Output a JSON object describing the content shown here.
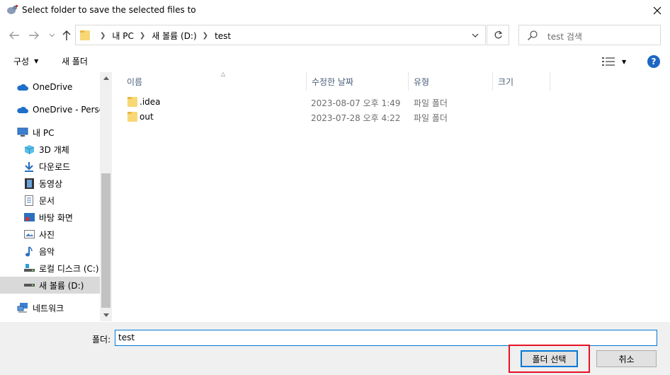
{
  "window": {
    "title": "Select folder to save the selected files to"
  },
  "address": {
    "crumbs": [
      "내 PC",
      "새 볼륨 (D:)",
      "test"
    ]
  },
  "search": {
    "placeholder": "test 검색"
  },
  "toolbar": {
    "organize_label": "구성",
    "new_folder_label": "새 폴더",
    "help_label": "?"
  },
  "sidebar": {
    "items": [
      {
        "label": "OneDrive",
        "icon": "cloud-icon"
      },
      {
        "label": "OneDrive - Personal",
        "icon": "cloud-icon"
      },
      {
        "label": "내 PC",
        "icon": "computer-icon"
      },
      {
        "label": "3D 개체",
        "icon": "cube-icon"
      },
      {
        "label": "다운로드",
        "icon": "download-icon"
      },
      {
        "label": "동영상",
        "icon": "video-icon"
      },
      {
        "label": "문서",
        "icon": "document-icon"
      },
      {
        "label": "바탕 화면",
        "icon": "desktop-icon"
      },
      {
        "label": "사진",
        "icon": "picture-icon"
      },
      {
        "label": "음악",
        "icon": "music-icon"
      },
      {
        "label": "로컬 디스크 (C:)",
        "icon": "drive-icon"
      },
      {
        "label": "새 볼륨 (D:)",
        "icon": "drive-icon"
      },
      {
        "label": "네트워크",
        "icon": "network-icon"
      }
    ]
  },
  "files": {
    "columns": [
      "이름",
      "수정한 날짜",
      "유형",
      "크기"
    ],
    "rows": [
      {
        "name": ".idea",
        "modified": "2023-08-07 오후 1:49",
        "type": "파일 폴더"
      },
      {
        "name": "out",
        "modified": "2023-07-28 오후 4:22",
        "type": "파일 폴더"
      }
    ]
  },
  "footer": {
    "folder_label": "폴더:",
    "folder_value": "test",
    "select_label": "폴더 선택",
    "cancel_label": "취소"
  },
  "colors": {
    "accent": "#0078d7",
    "highlight_border": "#e81123",
    "folder": "#f8d775"
  }
}
